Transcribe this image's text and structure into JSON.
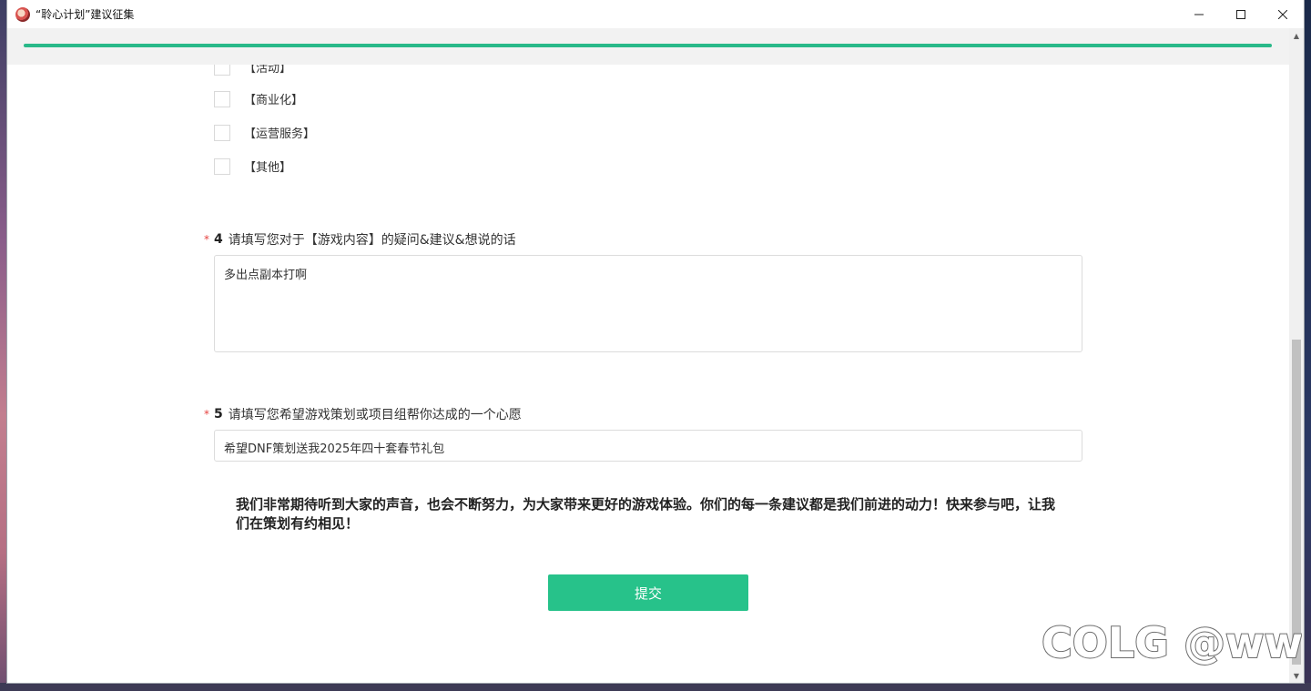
{
  "window": {
    "title": "“聆心计划”建议征集"
  },
  "progress": {
    "fraction": 1.0
  },
  "options": [
    {
      "label": "【活动】"
    },
    {
      "label": "【商业化】"
    },
    {
      "label": "【运营服务】"
    },
    {
      "label": "【其他】"
    }
  ],
  "q4": {
    "required_mark": "*",
    "number": "4",
    "title": "请填写您对于【游戏内容】的疑问&建议&想说的话",
    "value": "多出点副本打啊"
  },
  "q5": {
    "required_mark": "*",
    "number": "5",
    "title": "请填写您希望游戏策划或项目组帮你达成的一个心愿",
    "value": "希望DNF策划送我2025年四十套春节礼包"
  },
  "closing_text": "我们非常期待听到大家的声音，也会不断努力，为大家带来更好的游戏体验。你们的每一条建议都是我们前进的动力！快来参与吧，让我们在策划有约相见！",
  "submit_label": "提交",
  "watermark_text": "COLG @ww",
  "colors": {
    "accent": "#27c28a",
    "progress": "#29b989",
    "required": "#e64340"
  }
}
